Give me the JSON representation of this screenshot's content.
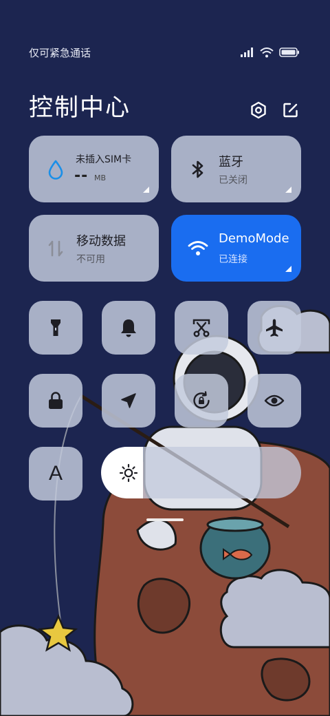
{
  "status_bar": {
    "carrier_text": "仅可紧急通话",
    "icons": [
      "signal-icon",
      "wifi-icon",
      "battery-icon"
    ]
  },
  "header": {
    "title": "控制中心",
    "settings_icon": "hexagon-settings-icon",
    "edit_icon": "edit-icon"
  },
  "tiles": {
    "sim": {
      "title": "未插入SIM卡",
      "value": "--",
      "unit": "MB",
      "icon": "water-drop-icon"
    },
    "bluetooth": {
      "title": "蓝牙",
      "status": "已关闭",
      "icon": "bluetooth-icon"
    },
    "mobile_data": {
      "title": "移动数据",
      "status": "不可用",
      "icon": "data-arrows-icon"
    },
    "wifi": {
      "title": "DemoMode",
      "status": "已连接",
      "icon": "wifi-icon",
      "active_color": "#1a6df0"
    }
  },
  "toggles": [
    {
      "name": "flashlight",
      "icon": "flashlight-icon"
    },
    {
      "name": "ringer",
      "icon": "bell-icon"
    },
    {
      "name": "screenshot",
      "icon": "scissors-icon"
    },
    {
      "name": "airplane-mode",
      "icon": "airplane-icon"
    },
    {
      "name": "lock-screen",
      "icon": "lock-icon"
    },
    {
      "name": "location",
      "icon": "location-arrow-icon"
    },
    {
      "name": "rotation-lock",
      "icon": "rotate-lock-icon"
    },
    {
      "name": "reading-mode",
      "icon": "eye-icon"
    },
    {
      "name": "font-size",
      "icon": "font-icon",
      "label": "A"
    }
  ],
  "brightness": {
    "icon": "sun-icon",
    "level_fraction": 0.21
  }
}
